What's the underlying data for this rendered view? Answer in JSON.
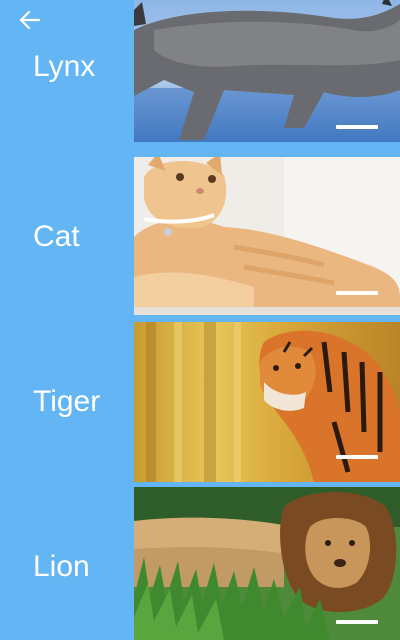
{
  "header": {
    "back_icon": "arrow-left-icon"
  },
  "animals": [
    {
      "label": "Lynx",
      "image_icon": "lynx-photo"
    },
    {
      "label": "Cat",
      "image_icon": "cat-photo"
    },
    {
      "label": "Tiger",
      "image_icon": "tiger-photo"
    },
    {
      "label": "Lion",
      "image_icon": "lion-photo"
    }
  ],
  "colors": {
    "background": "#63b6f3",
    "label_text": "#ffffff",
    "indicator": "#ffffff"
  }
}
